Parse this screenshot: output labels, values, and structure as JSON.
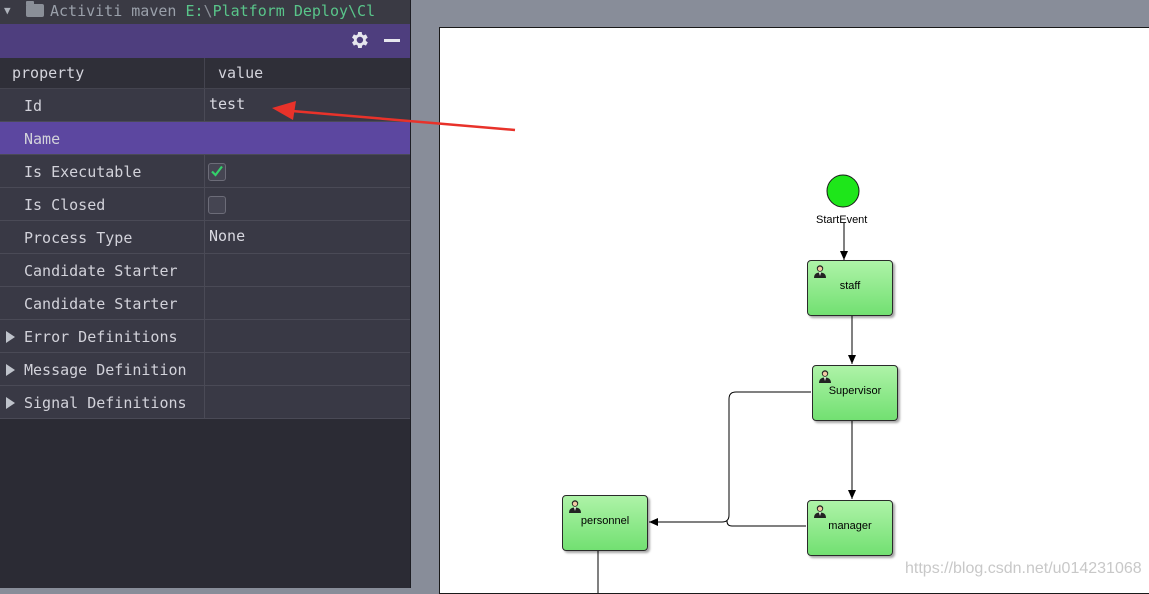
{
  "project_bar": {
    "name": "Activiti maven",
    "path_drive": "E:",
    "sep": "\\",
    "path_tail": "Platform Deploy\\Cl"
  },
  "toolbar": {
    "settings_icon": "gear-icon",
    "minimize_icon": "minus-icon"
  },
  "table": {
    "col_property": "property",
    "col_value": "value",
    "rows": [
      {
        "label": "Id",
        "value": "test"
      },
      {
        "label": "Name",
        "value": ""
      },
      {
        "label": "Is Executable",
        "checked": true
      },
      {
        "label": "Is Closed",
        "checked": false
      },
      {
        "label": "Process Type",
        "value": "None"
      },
      {
        "label": "Candidate Starter",
        "value": ""
      },
      {
        "label": "Candidate Starter",
        "value": ""
      },
      {
        "label": "Error Definitions",
        "value": ""
      },
      {
        "label": "Message Definition",
        "value": ""
      },
      {
        "label": "Signal Definitions",
        "value": ""
      }
    ]
  },
  "diagram": {
    "start_event": "StartEvent",
    "tasks": {
      "staff": "staff",
      "supervisor": "Supervisor",
      "manager": "manager",
      "personnel": "personnel"
    }
  },
  "colors": {
    "annotation_arrow": "#e8322a",
    "task_fill": "#8fe88a",
    "start_fill": "#1ee61a",
    "selected_row": "#5c47a0"
  },
  "watermark": "https://blog.csdn.net/u014231068"
}
